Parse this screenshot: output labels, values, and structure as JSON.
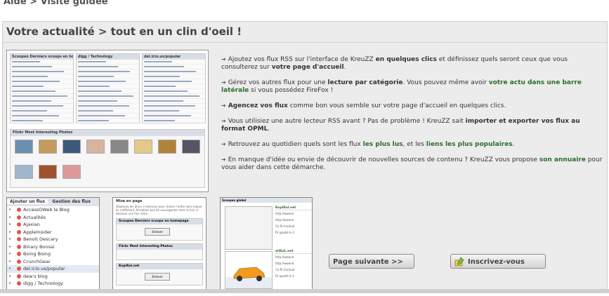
{
  "breadcrumb": "Aide > Visite guidée",
  "panel": {
    "title": "Votre actualité > tout en un clin d'oeil !"
  },
  "features": [
    {
      "parts": [
        {
          "t": "Ajoutez vos flux RSS sur l'interface de KreuZZ "
        },
        {
          "t": "en quelques clics",
          "b": true
        },
        {
          "t": " et définissez quels seront ceux que vous consulterez sur "
        },
        {
          "t": "votre page d'accueil",
          "b": true
        },
        {
          "t": "."
        }
      ]
    },
    {
      "parts": [
        {
          "t": "Gérez vos autres flux pour une "
        },
        {
          "t": "lecture par catégorie",
          "b": true
        },
        {
          "t": ". Vous pouvez même avoir "
        },
        {
          "t": "votre actu dans une barre latérale",
          "hl": true
        },
        {
          "t": " si vous possédez FireFox !"
        }
      ]
    },
    {
      "parts": [
        {
          "t": "Agencez vos flux",
          "b": true
        },
        {
          "t": " comme bon vous semble sur votre page d'accueil en quelques clics."
        }
      ]
    },
    {
      "parts": [
        {
          "t": "Vous utilisiez une autre lecteur RSS avant ? Pas de problème ! KreuZZ sait "
        },
        {
          "t": "importer et exporter vos flux au format OPML",
          "b": true
        },
        {
          "t": "."
        }
      ]
    },
    {
      "parts": [
        {
          "t": "Retrouvez au quotidien quels sont les flux "
        },
        {
          "t": "les plus lus",
          "hl": true
        },
        {
          "t": ", et les "
        },
        {
          "t": "liens les plus populaires",
          "hl": true
        },
        {
          "t": "."
        }
      ]
    },
    {
      "parts": [
        {
          "t": "En manque d'idée ou envie de découvrir de nouvelles sources de contenu ? KreuZZ vous propose "
        },
        {
          "t": "son annuaire",
          "hl": true
        },
        {
          "t": " pour vous aider dans cette démarche."
        }
      ]
    }
  ],
  "thumb_main": {
    "col1_title": "Scoopeo Derniers scoops en homepage",
    "col2_title": "digg / Technology",
    "col3_title": "del.icio.us/popular",
    "photos_title": "Flickr Most Interesting Photos"
  },
  "thumb_feeds": {
    "tabs": [
      "Ajouter un flux",
      "Gestion des flux"
    ],
    "items": [
      "AccessOWeb le Blog",
      "Actualités",
      "Ajaxian",
      "AppleInsider",
      "Benoit Descary",
      "Binary Bonsai",
      "Boing Boing",
      "CrunchGear",
      "del.icio.us/popular",
      "dew's blog",
      "digg / Technology"
    ]
  },
  "thumb_layout": {
    "head": "Mise en page",
    "text": "Déplacez les blocs ci-dessous pour choisir l'ordre dans lequel ils s'affichent. N'oubliez pas de sauvegarder avec le lien ci-dessous une fois votre...",
    "boxes": [
      "Scoopeo Derniers scoops en homepage",
      "Flickr Most Interesting Photos",
      "KopiKol.net"
    ],
    "remove_label": "Enlever"
  },
  "thumb_side": {
    "head": "Scoopeo global",
    "blocks": [
      {
        "name": "KopiKol.net",
        "items": [
          "http://www.kr",
          "http://www.kr",
          "Ce fil d'actual",
          "Fil ajouté le 2"
        ]
      },
      {
        "name": "eliKoL.net",
        "items": [
          "http://www.el",
          "http://www.el",
          "Ce fil d'actual",
          "Fil ajouté le 2"
        ]
      }
    ]
  },
  "buttons": {
    "next": "Page suivante >>",
    "register": "Inscrivez-vous"
  },
  "colors": {
    "accent_green": "#2a6e2a",
    "panel_bg": "#ececec",
    "dot_red": "#e8524a"
  }
}
